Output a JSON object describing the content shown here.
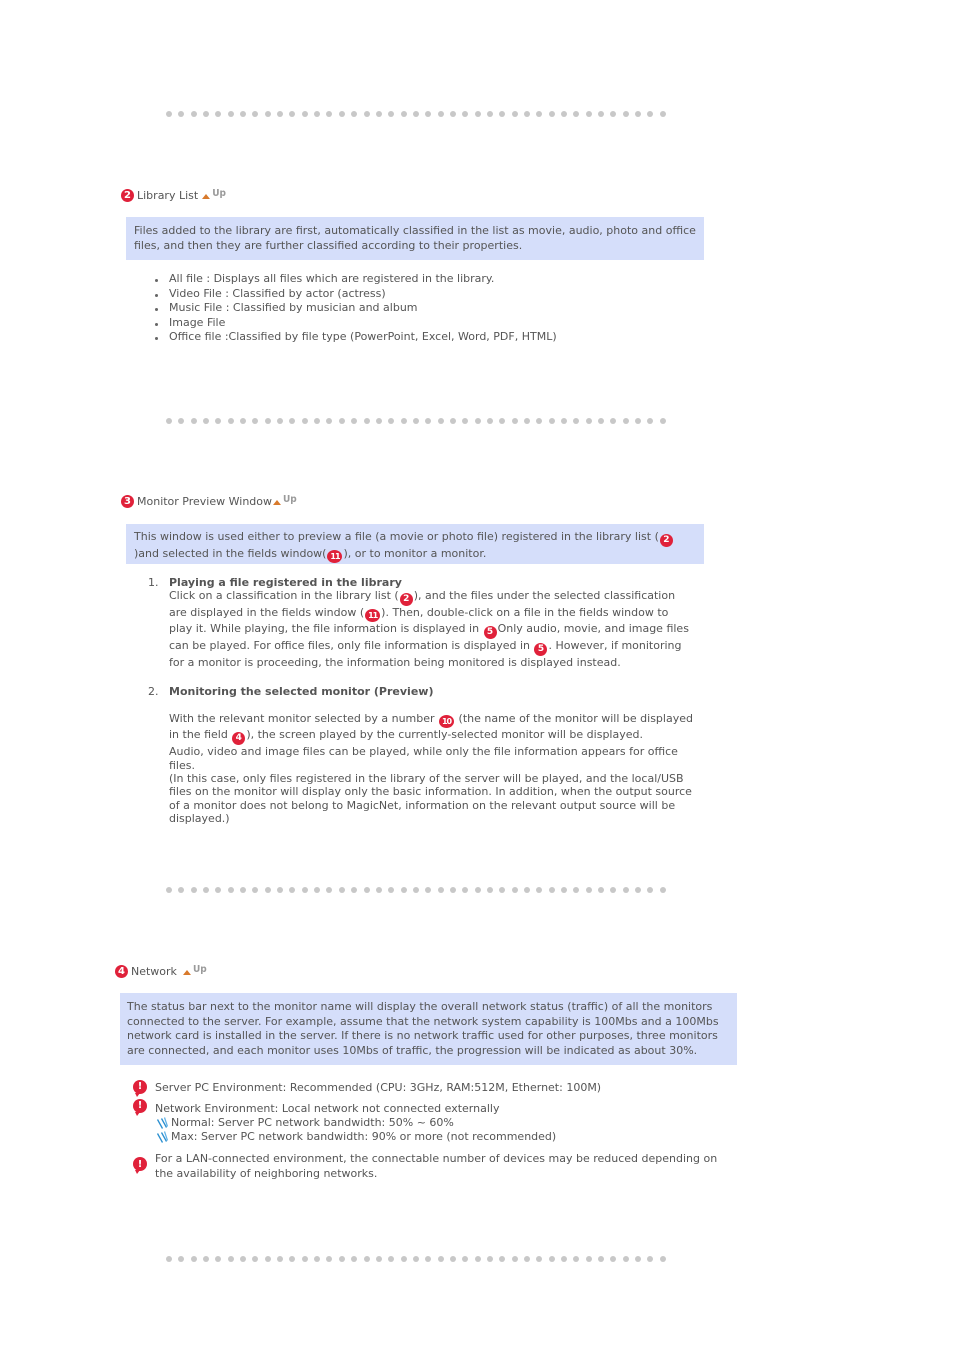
{
  "sections": {
    "library_list": {
      "number": "2",
      "title": "Library List",
      "up_label": "Up",
      "description": "Files added to the library are first, automatically classified in the list as movie, audio, photo and office files, and then they are further classified according to their properties.",
      "items": [
        "All file : Displays all files which are registered in the library.",
        "Video File : Classified by actor (actress)",
        "Music File : Classified by musician and album",
        "Image File",
        "Office file :Classified by file type (PowerPoint, Excel, Word, PDF, HTML)"
      ]
    },
    "monitor_preview": {
      "number": "3",
      "title": "Monitor Preview Window",
      "up_label": "Up",
      "description": {
        "part1": "This window is used either to preview a file (a movie or photo file) registered in the library list (",
        "ref1": "2",
        "part2": ")and selected in the fields window(",
        "ref2": "11",
        "part3": "), or to monitor a monitor."
      },
      "steps": [
        {
          "marker": "1.",
          "title": "Playing a file registered in the library",
          "text": {
            "t1": "Click on a classification in the library list (",
            "r1": "2",
            "t2": "), and the files under the selected classification are displayed in the fields window (",
            "r2": "11",
            "t3": "). Then, double-click on a file in the fields window to play it. While playing, the file information is displayed in ",
            "r3": "5",
            "t4": "Only audio, movie, and image files can be played. For office files, only file information is displayed in ",
            "r4": "5",
            "t5": ". However, if monitoring for a monitor is proceeding, the information being monitored is displayed instead."
          }
        },
        {
          "marker": "2.",
          "title": "Monitoring the selected monitor (Preview)",
          "text": {
            "t1": "With the relevant monitor selected by a number ",
            "r1": "10",
            "t2": " (the name of the monitor will be displayed in the field ",
            "r2": "4",
            "t3": "), the screen played by the currently-selected monitor will be displayed.",
            "line2": "Audio, video and image files can be played, while only the file information appears for office files.",
            "line3": "(In this case, only files registered in the library of the server will be played, and the local/USB files on the monitor will display only the basic information. In addition, when the output source of a monitor does not belong to MagicNet, information on the relevant output source will be displayed.)"
          }
        }
      ]
    },
    "network": {
      "number": "4",
      "title": "Network",
      "up_label": "Up",
      "description": "The status bar next to the monitor name will display the overall network status (traffic) of all the monitors connected to the server. For example, assume that the network system capability is 100Mbs and a 100Mbs network card is installed in the server. If there is no network traffic used for other purposes, three monitors are connected, and each monitor uses 10Mbs of traffic, the progression will be indicated as about 30%.",
      "notes": [
        {
          "icon": "warning-icon",
          "text": "Server PC Environment: Recommended (CPU: 3GHz, RAM:512M, Ethernet: 100M)"
        },
        {
          "icon": "warning-icon",
          "text": "Network Environment: Local network not connected externally",
          "subitems": [
            {
              "icon": "pen-icon",
              "text": "Normal: Server PC network bandwidth: 50% ~ 60%"
            },
            {
              "icon": "pen-icon",
              "text": "Max: Server PC network bandwidth: 90% or more (not recommended)"
            }
          ]
        },
        {
          "icon": "warning-icon",
          "text": "For a LAN-connected environment, the connectable number of devices may be reduced depending on the availability of neighboring networks."
        }
      ]
    }
  },
  "colors": {
    "badge": "#e0213a",
    "infobox_bg": "#d5defa",
    "text": "#555555",
    "up_arrow": "#d87a2c",
    "divider_dot": "#c8c8c8",
    "pen": "#2a8fd0"
  }
}
